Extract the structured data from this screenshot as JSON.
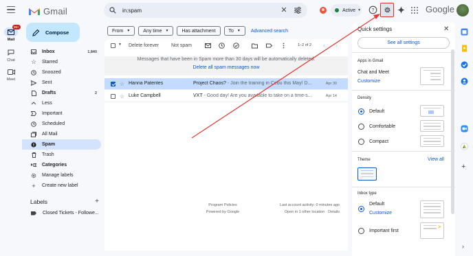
{
  "app": {
    "logo_text": "Gmail"
  },
  "search": {
    "query": "in:spam"
  },
  "status": {
    "label": "Active"
  },
  "google_word": "Google",
  "rail": {
    "mail_label": "Mail",
    "mail_badge": "99+",
    "chat_label": "Chat",
    "meet_label": "Meet"
  },
  "compose_label": "Compose",
  "nav": [
    {
      "label": "Inbox",
      "count": "1,840",
      "icon": "inbox-icon"
    },
    {
      "label": "Starred",
      "count": "",
      "icon": "star-icon"
    },
    {
      "label": "Snoozed",
      "count": "",
      "icon": "clock-icon"
    },
    {
      "label": "Sent",
      "count": "",
      "icon": "send-icon"
    },
    {
      "label": "Drafts",
      "count": "2",
      "icon": "draft-icon"
    },
    {
      "label": "Less",
      "count": "",
      "icon": "chevron-up-icon"
    },
    {
      "label": "Important",
      "count": "",
      "icon": "important-icon"
    },
    {
      "label": "Scheduled",
      "count": "",
      "icon": "scheduled-icon"
    },
    {
      "label": "All Mail",
      "count": "",
      "icon": "all-mail-icon"
    },
    {
      "label": "Spam",
      "count": "",
      "icon": "spam-icon"
    },
    {
      "label": "Trash",
      "count": "",
      "icon": "trash-icon"
    },
    {
      "label": "Categories",
      "count": "",
      "icon": "categories-icon"
    },
    {
      "label": "Manage labels",
      "count": "",
      "icon": "gear-icon"
    },
    {
      "label": "Create new label",
      "count": "",
      "icon": "plus-icon"
    }
  ],
  "labels": {
    "heading": "Labels",
    "items": [
      "Closed Tickets - Followe..."
    ]
  },
  "filters": {
    "from": "From",
    "any_time": "Any time",
    "has_attachment": "Has attachment",
    "to": "To",
    "advanced": "Advanced search"
  },
  "toolbar": {
    "delete_forever": "Delete forever",
    "not_spam": "Not spam",
    "pager": "1–2 of 2"
  },
  "banner": {
    "text": "Messages that have been in Spam more than 30 days will be automatically deleted.",
    "link": "Delete all spam messages now"
  },
  "emails": [
    {
      "sender": "Hanna Patentes",
      "subject": "Project Chaos?",
      "snippet": " - Join the training in Cebu this May! D...",
      "date": "Apr 30"
    },
    {
      "sender": "Luke Campbell",
      "subject": "VXT",
      "snippet": " - Good day! Are you available to take on a time-s...",
      "date": "Apr 14"
    }
  ],
  "footer": {
    "program_policies": "Program Policies",
    "powered_by": "Powered by Google",
    "last_activity": "Last account activity: 0 minutes ago",
    "open_in": "Open in 1 other location · Details"
  },
  "quick_settings": {
    "title": "Quick settings",
    "see_all": "See all settings",
    "apps_heading": "Apps in Gmail",
    "chat_meet": "Chat and Meet",
    "customize": "Customize",
    "density_heading": "Density",
    "density_options": [
      "Default",
      "Comfortable",
      "Compact"
    ],
    "theme_heading": "Theme",
    "view_all": "View all",
    "inbox_type_heading": "Inbox type",
    "inbox_default": "Default",
    "inbox_customize": "Customize",
    "important_first": "Important first"
  },
  "colors": {
    "accent": "#0b57d0",
    "annotation": "#d93025",
    "compose": "#c2e7ff",
    "selected_row": "#c2dbff"
  }
}
